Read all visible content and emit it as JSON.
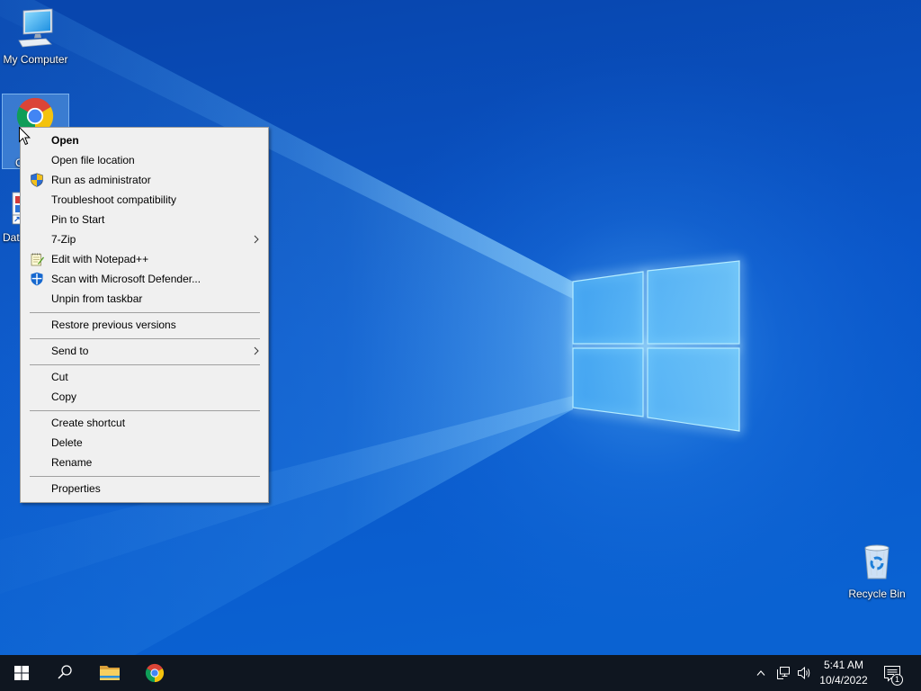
{
  "desktop": {
    "icons": {
      "my_computer": {
        "label": "My Computer",
        "icon": "computer-icon"
      },
      "chrome": {
        "label": "C",
        "icon": "chrome-icon",
        "selected": true
      },
      "data": {
        "label": "Dat",
        "icon": "document-shortcut-icon"
      },
      "recycle_bin": {
        "label": "Recycle Bin",
        "icon": "recycle-bin-icon"
      }
    }
  },
  "context_menu": {
    "items": [
      {
        "label": "Open",
        "default": true
      },
      {
        "label": "Open file location"
      },
      {
        "label": "Run as administrator",
        "icon": "uac-shield-icon"
      },
      {
        "label": "Troubleshoot compatibility"
      },
      {
        "label": "Pin to Start"
      },
      {
        "label": "7-Zip",
        "submenu": true
      },
      {
        "label": "Edit with Notepad++",
        "icon": "notepad-plus-plus-icon"
      },
      {
        "label": "Scan with Microsoft Defender...",
        "icon": "defender-shield-icon"
      },
      {
        "label": "Unpin from taskbar"
      },
      {
        "label": "Restore previous versions"
      },
      {
        "label": "Send to",
        "submenu": true
      },
      {
        "label": "Cut"
      },
      {
        "label": "Copy"
      },
      {
        "label": "Create shortcut"
      },
      {
        "label": "Delete"
      },
      {
        "label": "Rename"
      },
      {
        "label": "Properties"
      }
    ]
  },
  "taskbar": {
    "start_icon": "windows-logo-icon",
    "search_icon": "search-icon",
    "pinned": [
      {
        "icon": "file-explorer-icon"
      },
      {
        "icon": "chrome-icon"
      }
    ],
    "tray": {
      "icons": [
        "chevron-up-icon",
        "network-icon",
        "volume-icon"
      ],
      "clock": {
        "time": "5:41 AM",
        "date": "10/4/2022"
      },
      "notifications": {
        "icon": "action-center-icon",
        "count": "1"
      }
    }
  },
  "colors": {
    "desktop_blue": "#0b5acd",
    "menu_background": "#f0f0f0",
    "menu_separator": "#a0a0a0",
    "taskbar_background": "#0f1620",
    "selection_fill": "#8cc8fa"
  }
}
